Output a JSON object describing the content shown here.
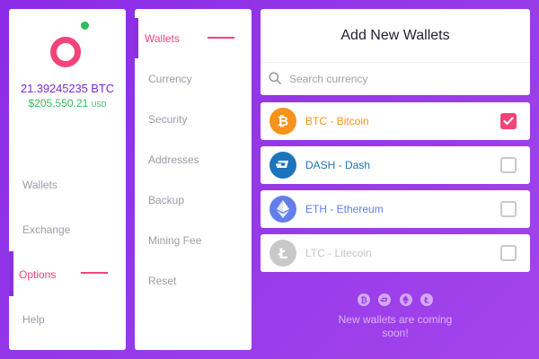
{
  "balance": {
    "btc": "21.39245235 BTC",
    "usd": "$205,550.21",
    "usd_unit": "USD"
  },
  "main_nav": {
    "items": [
      {
        "label": "Wallets",
        "active": false
      },
      {
        "label": "Exchange",
        "active": false
      },
      {
        "label": "Options",
        "active": true
      },
      {
        "label": "Help",
        "active": false
      }
    ]
  },
  "sub_nav": {
    "items": [
      {
        "label": "Wallets",
        "active": true
      },
      {
        "label": "Currency",
        "active": false
      },
      {
        "label": "Security",
        "active": false
      },
      {
        "label": "Addresses",
        "active": false
      },
      {
        "label": "Backup",
        "active": false
      },
      {
        "label": "Mining Fee",
        "active": false
      },
      {
        "label": "Reset",
        "active": false
      }
    ]
  },
  "add_wallets": {
    "title": "Add New Wallets",
    "search_placeholder": "Search currency",
    "currencies": [
      {
        "label": "BTC - Bitcoin",
        "icon": "bitcoin-icon",
        "color": "#f7931a",
        "checked": true,
        "disabled": false
      },
      {
        "label": "DASH - Dash",
        "icon": "dash-icon",
        "color": "#1c75bc",
        "checked": false,
        "disabled": false
      },
      {
        "label": "ETH - Ethereum",
        "icon": "ethereum-icon",
        "color": "#627eea",
        "checked": false,
        "disabled": false
      },
      {
        "label": "LTC - Litecoin",
        "icon": "litecoin-icon",
        "color": "#c8c8c8",
        "checked": false,
        "disabled": true
      }
    ],
    "footer_icons": [
      "bitcoin-icon",
      "dash-icon",
      "ethereum-icon",
      "litecoin-icon"
    ],
    "footer_text": "New wallets are coming soon!"
  },
  "colors": {
    "accent": "#f2447a",
    "brand_purple": "#8a30e3",
    "positive": "#2ebd59",
    "background": "#9437e8"
  }
}
